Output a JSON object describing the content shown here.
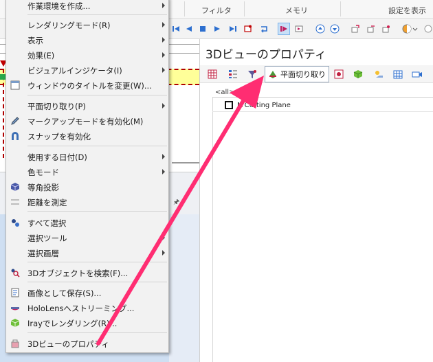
{
  "ribbon": {
    "groups": [
      {
        "label": "フィルタ"
      },
      {
        "label": "メモリ"
      },
      {
        "label": "設定を表示"
      }
    ]
  },
  "context_menu": {
    "items": [
      {
        "label": "作業環境を作成...",
        "icon": "none",
        "submenu": true
      },
      {
        "label": "レンダリングモード(R)",
        "icon": "none",
        "submenu": true
      },
      {
        "label": "表示",
        "icon": "none",
        "submenu": true
      },
      {
        "label": "効果(E)",
        "icon": "none",
        "submenu": true
      },
      {
        "label": "ビジュアルインジケータ(I)",
        "icon": "none",
        "submenu": true
      },
      {
        "label": "ウィンドウのタイトルを変更(W)...",
        "icon": "window-title-icon",
        "submenu": false
      },
      {
        "label": "平面切り取り(P)",
        "icon": "none",
        "submenu": true
      },
      {
        "label": "マークアップモードを有効化(M)",
        "icon": "pencil-icon",
        "submenu": false
      },
      {
        "label": "スナップを有効化",
        "icon": "magnet-icon",
        "submenu": false
      },
      {
        "label": "使用する日付(D)",
        "icon": "none",
        "submenu": true
      },
      {
        "label": "色モード",
        "icon": "none",
        "submenu": true
      },
      {
        "label": "等角投影",
        "icon": "isometric-cube-icon",
        "submenu": false
      },
      {
        "label": "距離を測定",
        "icon": "measure-icon",
        "submenu": false
      },
      {
        "label": "すべて選択",
        "icon": "select-all-icon",
        "submenu": false
      },
      {
        "label": "選択ツール",
        "icon": "none",
        "submenu": true
      },
      {
        "label": "選択画層",
        "icon": "none",
        "submenu": true
      },
      {
        "label": "3Dオブジェクトを検索(F)...",
        "icon": "search-objects-icon",
        "submenu": false
      },
      {
        "label": "画像として保存(S)...",
        "icon": "save-image-icon",
        "submenu": false
      },
      {
        "label": "HoloLensへストリーミング...",
        "icon": "hololens-icon",
        "submenu": false
      },
      {
        "label": "Irayでレンダリング(R)...",
        "icon": "iray-icon",
        "submenu": false
      },
      {
        "label": "3Dビューのプロパティ",
        "icon": "properties-icon",
        "submenu": false
      }
    ]
  },
  "properties_panel": {
    "title": "3Dビューのプロパティ",
    "active_section_label": "平面切り取り",
    "filter_text": "<all>",
    "tree_items": [
      {
        "label": "Cutting Plane",
        "prefix": "M",
        "checked": false
      }
    ]
  },
  "colors": {
    "accent_arrow": "#ff2d72",
    "menu_bg": "#f2f2f2",
    "highlight_yellow": "#ffff99",
    "dashed_red": "#b00000"
  }
}
